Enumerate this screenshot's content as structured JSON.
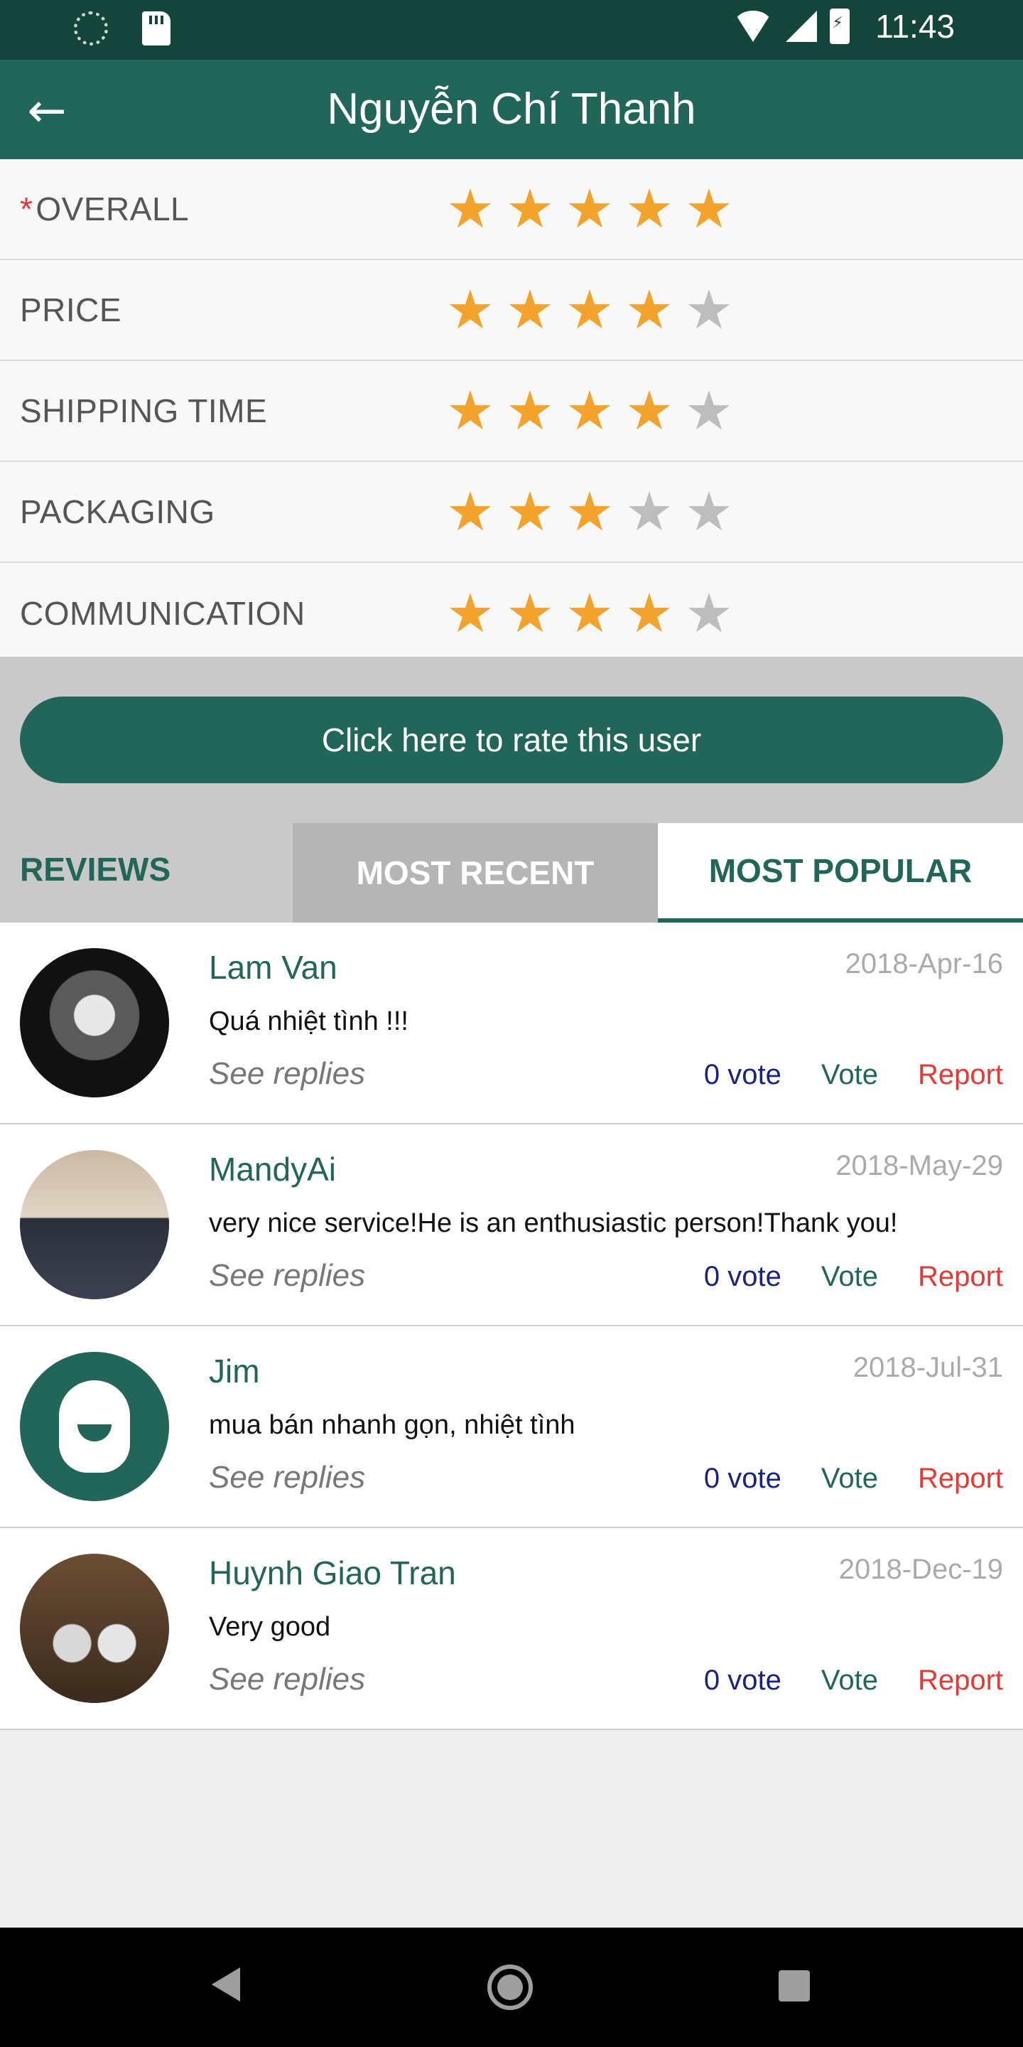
{
  "status_bar": {
    "time": "11:43"
  },
  "app_bar": {
    "title": "Nguyễn Chí Thanh"
  },
  "ratings": [
    {
      "label": "OVERALL",
      "required": true,
      "stars": 5
    },
    {
      "label": "PRICE",
      "required": false,
      "stars": 4
    },
    {
      "label": "SHIPPING TIME",
      "required": false,
      "stars": 4
    },
    {
      "label": "PACKAGING",
      "required": false,
      "stars": 3
    },
    {
      "label": "COMMUNICATION",
      "required": false,
      "stars": 4
    }
  ],
  "required_marker": "*",
  "rate_button": "Click here to rate this user",
  "tabs": {
    "section_label": "REVIEWS",
    "recent": "MOST RECENT",
    "popular": "MOST POPULAR"
  },
  "reviews": [
    {
      "name": "Lam Van",
      "date": "2018-Apr-16",
      "comment": "Quá nhiệt tình !!!",
      "see_replies": "See replies",
      "votes": "0 vote",
      "vote_label": "Vote",
      "report_label": "Report"
    },
    {
      "name": "MandyAi",
      "date": "2018-May-29",
      "comment": "very nice service!He is an enthusiastic person!Thank you!",
      "see_replies": "See replies",
      "votes": "0 vote",
      "vote_label": "Vote",
      "report_label": "Report"
    },
    {
      "name": "Jim",
      "date": "2018-Jul-31",
      "comment": "mua bán nhanh gọn, nhiệt tình",
      "see_replies": "See replies",
      "votes": "0 vote",
      "vote_label": "Vote",
      "report_label": "Report"
    },
    {
      "name": "Huynh Giao Tran",
      "date": "2018-Dec-19",
      "comment": "Very good",
      "see_replies": "See replies",
      "votes": "0 vote",
      "vote_label": "Vote",
      "report_label": "Report"
    }
  ],
  "colors": {
    "primary": "#22665a",
    "status_bar": "#14453a",
    "star_on": "#f3a22b",
    "star_off": "#bdbdbd",
    "report": "#e53935",
    "vote_count": "#1a237e"
  }
}
